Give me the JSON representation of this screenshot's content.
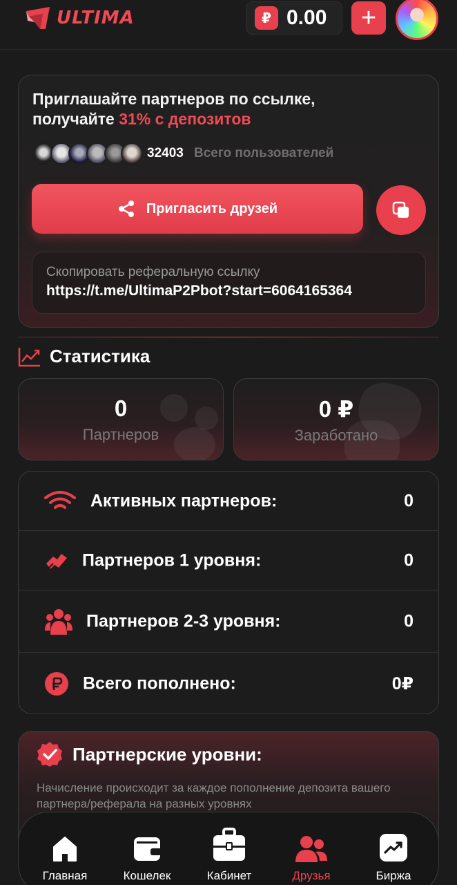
{
  "header": {
    "brand": "ULTIMA",
    "currency_symbol": "₽",
    "balance": "0.00",
    "add_label": "+"
  },
  "invite": {
    "title_line1": "Приглашайте партнеров по ссылке,",
    "title_line2_prefix": "получайте ",
    "title_highlight": "31% с депозитов",
    "users_count": "32403",
    "users_label": "Всего пользователей",
    "invite_button": "Пригласить друзей",
    "copy_label": "Скопировать реферальную ссылку",
    "ref_link": "https://t.me/UltimaP2Pbot?start=6064165364"
  },
  "stats": {
    "title": "Статистика",
    "partners_value": "0",
    "partners_label": "Партнеров",
    "earned_value": "0 ₽",
    "earned_label": "Заработано",
    "rows": [
      {
        "label": "Активных партнеров:",
        "value": "0",
        "icon": "wifi-icon"
      },
      {
        "label": "Партнеров 1 уровня:",
        "value": "0",
        "icon": "handshake-icon"
      },
      {
        "label": "Партнеров 2-3 уровня:",
        "value": "0",
        "icon": "users-icon"
      },
      {
        "label": "Всего пополнено:",
        "value": "0₽",
        "icon": "ruble-icon"
      }
    ]
  },
  "levels": {
    "title": "Партнерские уровни:",
    "description": "Начисление происходит за каждое пополнение депозита вашего партнера/реферала на разных уровнях"
  },
  "nav": {
    "items": [
      {
        "label": "Главная",
        "icon": "home-icon"
      },
      {
        "label": "Кошелек",
        "icon": "wallet-icon"
      },
      {
        "label": "Кабинет",
        "icon": "briefcase-icon"
      },
      {
        "label": "Друзья",
        "icon": "friends-icon"
      },
      {
        "label": "Биржа",
        "icon": "chart-icon"
      }
    ],
    "active": "Друзья"
  },
  "colors": {
    "accent": "#e8404c",
    "background": "#1b1b1b",
    "muted_text": "#7a7a7a"
  }
}
